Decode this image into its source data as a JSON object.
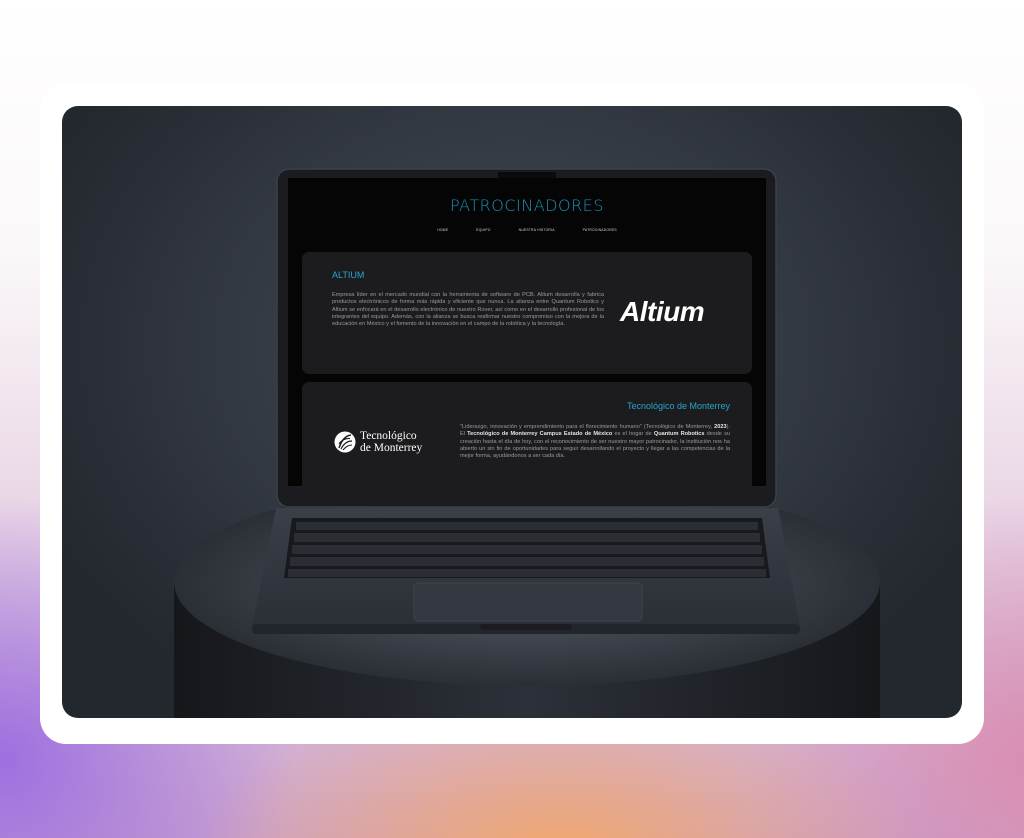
{
  "website": {
    "title": "PATROCINADORES",
    "nav": [
      "HOME",
      "EQUIPO",
      "NUESTRA HISTORIA",
      "PATROCINADORES"
    ],
    "sponsors": [
      {
        "heading": "ALTIUM",
        "text": "Empresa líder en el mercado mundial con la herramienta de software de PCB. Altium desarrolla y fabrica productos electrónicos de forma más rápida y eficiente que nunca. La alianza entre Quantum Robotics y Altium se enfocará en el desarrollo electrónico de nuestro Rover, así como en el desarrollo profesional de los integrantes del equipo. Además, con la alianza se busca reafirmar nuestro compromiso con la mejora de la educación en México y el fomento de la innovación en el campo de la robótica y la tecnología.",
        "logo_text": "Altium"
      },
      {
        "heading": "Tecnológico de Monterrey",
        "text_parts": [
          "\"Liderazgo, innovación y emprendimiento para el florecimiento humano\" (Tecnológico de Monterrey, ",
          "2023",
          "). El ",
          "Tecnológico de Monterrey Campus Estado de México",
          " es el hogar de ",
          "Quantum Robotics",
          " desde su creación hasta el día de hoy, con el reconocimiento de ser nuestro mayor patrocinador, la institución nos ha abierto un sin fin de oportunidades para seguir desarrollando el proyecto y llegar a las competencias de la mejor forma, ayudándonos a ser cada día."
        ],
        "logo_line1": "Tecnológico",
        "logo_line2": "de Monterrey"
      }
    ]
  },
  "colors": {
    "accent": "#29a3cc",
    "panel": "#1c1c1e",
    "screen_bg": "#050506"
  },
  "icons": {
    "tec_emblem": "tec-emblem-icon"
  }
}
